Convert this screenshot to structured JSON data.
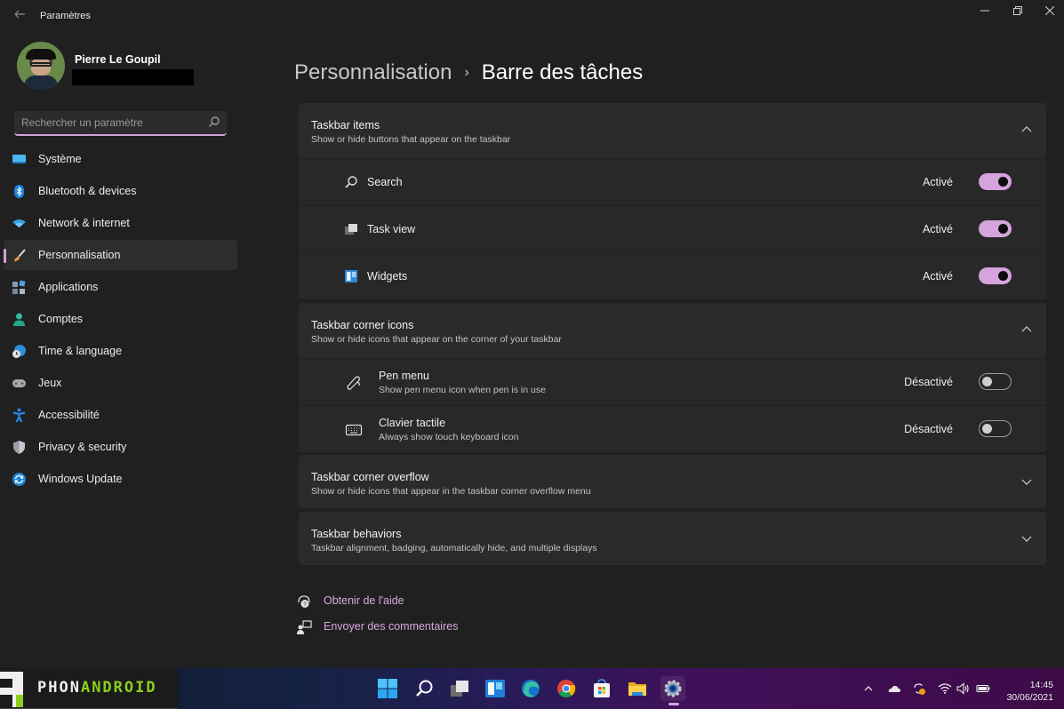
{
  "window": {
    "app_title": "Paramètres",
    "controls": {
      "minimize": "minimize",
      "maximize": "maximize",
      "close": "close"
    }
  },
  "profile": {
    "name": "Pierre Le Goupil",
    "email": "[redacted]"
  },
  "search": {
    "placeholder": "Rechercher un paramètre",
    "value": ""
  },
  "sidebar": {
    "active_index": 3,
    "items": [
      {
        "label": "Système",
        "icon": "monitor-icon"
      },
      {
        "label": "Bluetooth & devices",
        "icon": "bluetooth-icon"
      },
      {
        "label": "Network & internet",
        "icon": "wifi-icon"
      },
      {
        "label": "Personnalisation",
        "icon": "paintbrush-icon"
      },
      {
        "label": "Applications",
        "icon": "apps-icon"
      },
      {
        "label": "Comptes",
        "icon": "person-icon"
      },
      {
        "label": "Time & language",
        "icon": "globe-clock-icon"
      },
      {
        "label": "Jeux",
        "icon": "gamepad-icon"
      },
      {
        "label": "Accessibilité",
        "icon": "accessibility-icon"
      },
      {
        "label": "Privacy & security",
        "icon": "shield-icon"
      },
      {
        "label": "Windows Update",
        "icon": "update-icon"
      }
    ]
  },
  "breadcrumb": {
    "parent": "Personnalisation",
    "separator": "›",
    "current": "Barre des tâches"
  },
  "sections": [
    {
      "title": "Taskbar items",
      "subtitle": "Show or hide buttons that appear on the taskbar",
      "expanded": true,
      "rows": [
        {
          "label": "Search",
          "icon": "search-icon",
          "state": "Activé",
          "on": true
        },
        {
          "label": "Task view",
          "icon": "task-view-icon",
          "state": "Activé",
          "on": true
        },
        {
          "label": "Widgets",
          "icon": "widgets-icon",
          "state": "Activé",
          "on": true
        }
      ]
    },
    {
      "title": "Taskbar corner icons",
      "subtitle": "Show or hide icons that appear on the corner of your taskbar",
      "expanded": true,
      "rows": [
        {
          "label": "Pen menu",
          "sub": "Show pen menu icon when pen is in use",
          "icon": "pen-icon",
          "state": "Désactivé",
          "on": false
        },
        {
          "label": "Clavier tactile",
          "sub": "Always show touch keyboard icon",
          "icon": "keyboard-icon",
          "state": "Désactivé",
          "on": false
        }
      ]
    },
    {
      "title": "Taskbar corner overflow",
      "subtitle": "Show or hide icons that appear in the taskbar corner overflow menu",
      "expanded": false
    },
    {
      "title": "Taskbar behaviors",
      "subtitle": "Taskbar alignment, badging, automatically hide, and multiple displays",
      "expanded": false
    }
  ],
  "links": [
    {
      "label": "Obtenir de l'aide",
      "icon": "help-icon"
    },
    {
      "label": "Envoyer des commentaires",
      "icon": "feedback-icon"
    }
  ],
  "watermark": {
    "part1": "PHON",
    "part2": "ANDROID"
  },
  "taskbar": {
    "apps": [
      {
        "name": "start",
        "icon": "windows-start-icon"
      },
      {
        "name": "search",
        "icon": "search-icon"
      },
      {
        "name": "task-view",
        "icon": "task-view-icon"
      },
      {
        "name": "widgets",
        "icon": "widgets-icon"
      },
      {
        "name": "edge",
        "icon": "edge-icon"
      },
      {
        "name": "chrome",
        "icon": "chrome-icon"
      },
      {
        "name": "store",
        "icon": "store-icon"
      },
      {
        "name": "file-explorer",
        "icon": "folder-icon"
      },
      {
        "name": "settings",
        "icon": "settings-gear-icon",
        "active": true
      }
    ],
    "clock": {
      "time": "14:45",
      "date": "30/06/2021"
    }
  },
  "colors": {
    "accent": "#d6a3dd",
    "background": "#202020",
    "card": "#2b2b2b",
    "link": "#d9a7e0"
  }
}
